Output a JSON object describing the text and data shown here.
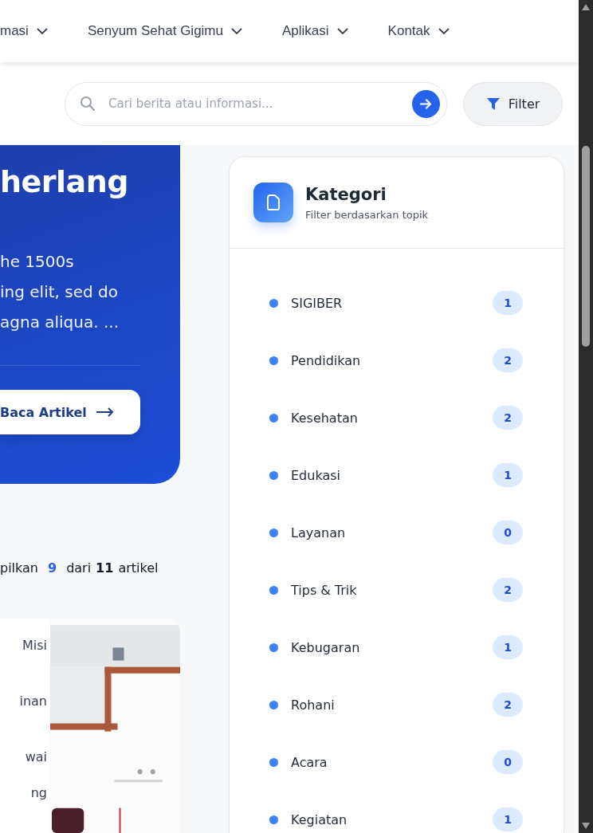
{
  "nav": {
    "items": [
      {
        "label": "masi"
      },
      {
        "label": "Senyum Sehat Gigimu"
      },
      {
        "label": "Aplikasi"
      },
      {
        "label": "Kontak"
      }
    ]
  },
  "search": {
    "placeholder": "Cari berita atau informasi..."
  },
  "filter_button": {
    "label": "Filter"
  },
  "hero": {
    "title": "herlang",
    "body": [
      "he 1500s",
      "ing elit, sed do",
      "agna aliqua. ..."
    ],
    "button": "Baca Artikel"
  },
  "result_count": {
    "prefix": "pilkan",
    "shown": "9",
    "middle": "dari",
    "total": "11",
    "suffix": "artikel"
  },
  "article_card": {
    "lines": [
      "Misi",
      "inan",
      "wai",
      "ng"
    ]
  },
  "sidebar": {
    "title": "Kategori",
    "subtitle": "Filter berdasarkan topik",
    "categories": [
      {
        "name": "SIGIBER",
        "count": "1"
      },
      {
        "name": "Pendidikan",
        "count": "2"
      },
      {
        "name": "Kesehatan",
        "count": "2"
      },
      {
        "name": "Edukasi",
        "count": "1"
      },
      {
        "name": "Layanan",
        "count": "0"
      },
      {
        "name": "Tips & Trik",
        "count": "2"
      },
      {
        "name": "Kebugaran",
        "count": "1"
      },
      {
        "name": "Rohani",
        "count": "2"
      },
      {
        "name": "Acara",
        "count": "0"
      },
      {
        "name": "Kegiatan",
        "count": "1"
      }
    ]
  }
}
